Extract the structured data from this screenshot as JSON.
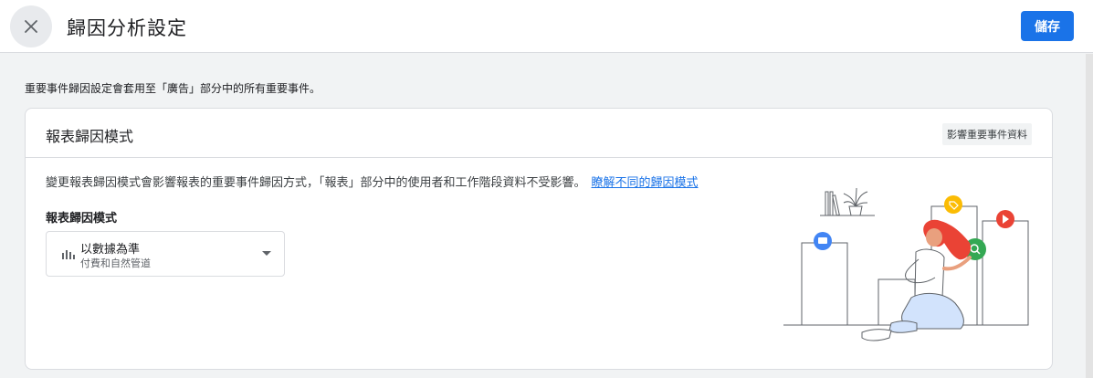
{
  "header": {
    "title": "歸因分析設定",
    "save_label": "儲存"
  },
  "intro_text": "重要事件歸因設定會套用至「廣告」部分中的所有重要事件。",
  "card": {
    "title": "報表歸因模式",
    "chip": "影響重要事件資料",
    "description": "變更報表歸因模式會影響報表的重要事件歸因方式，「報表」部分中的使用者和工作階段資料不受影響。",
    "link": "瞭解不同的歸因模式",
    "field_label": "報表歸因模式",
    "select": {
      "value": "以數據為準",
      "subtitle": "付費和自然管道"
    }
  },
  "colors": {
    "accent": "#1a73e8",
    "badge_blue": "#4285f4",
    "badge_yellow": "#fbbc04",
    "badge_red": "#ea4335",
    "badge_green": "#34a853"
  },
  "icons": {
    "close": "close-icon",
    "select": "bar-chart-icon",
    "dropdown": "caret-down-icon"
  }
}
